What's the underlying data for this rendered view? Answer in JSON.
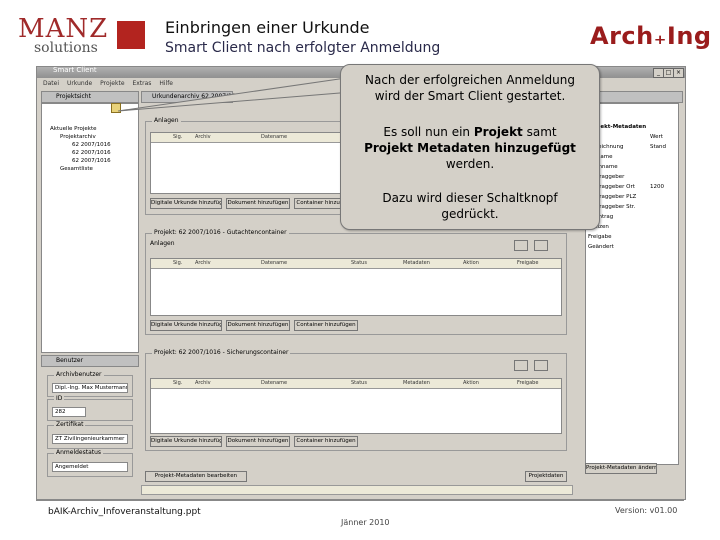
{
  "header": {
    "manz_logo": {
      "main": "MANZ",
      "sub": "solutions"
    },
    "title": "Einbringen einer Urkunde",
    "subtitle": "Smart Client nach erfolgter Anmeldung",
    "arch_logo": "Arch₊Ing"
  },
  "app": {
    "window_title": "Smart Client",
    "menu": [
      "Datei",
      "Urkunde",
      "Projekte",
      "Extras",
      "Hilfe"
    ],
    "tree_panel_tab": "Projektsicht",
    "tree": [
      "Aktuelle Projekte",
      "Projektarchiv",
      "62 2007/1016",
      "62 2007/1016",
      "62 2007/1016",
      "Gesamtliste"
    ],
    "doc_tab": "Urkundenarchiv 62 2007/1016",
    "table_header": [
      "Sig.",
      "Archiv",
      "Datename",
      "Status",
      "Metadaten",
      "Aktion",
      "Freigabe"
    ],
    "group_top_label": "Anlagen",
    "group_top_buttons": [
      "Digitale Urkunde hinzufügen",
      "Dokument hinzufügen",
      "Container hinzufügen"
    ],
    "group_mid_title": "Projekt: 62 2007/1016 - Gutachtencontainer",
    "group_mid_label": "Anlagen",
    "group_mid_buttons": [
      "Digitale Urkunde hinzufügen",
      "Dokument hinzufügen",
      "Container hinzufügen"
    ],
    "group_bot_title": "Projekt: 62 2007/1016 - Sicherungscontainer",
    "group_bot_buttons": [
      "Digitale Urkunde hinzufügen",
      "Dokument hinzufügen",
      "Container hinzufügen"
    ],
    "bottom_button_left": "Projekt-Metadaten bearbeiten",
    "bottom_button_right": "Projektdaten",
    "settings_tab": "Benutzer",
    "settings": [
      {
        "label": "Archivbenutzer",
        "value": "Dipl.-Ing. Max Mustermann"
      },
      {
        "label": "ID",
        "value": "282"
      },
      {
        "label": "Zertifikat",
        "value": "ZT Zivilingenieurkammer"
      },
      {
        "label": "Anmeldestatus",
        "value": "Angemeldet"
      }
    ],
    "right_panel": {
      "header": "Projekt-Metadaten",
      "items": [
        "...",
        "Abzeichnung",
        "Vorname",
        "Nachname",
        "Auftraggeber",
        "Auftraggeber Ort",
        "Auftraggeber PLZ",
        "Auftraggeber Str.",
        "Nachtrag",
        "Notizen",
        "Freigabe",
        "Geändert"
      ],
      "values": [
        "Wert",
        "Stand",
        "",
        "",
        "",
        "1200",
        "",
        ""
      ],
      "button": "Projekt-Metadaten ändern"
    }
  },
  "callout": {
    "line1": "Nach der erfolgreichen Anmeldung",
    "line2": "wird der Smart Client gestartet.",
    "line3_a": "Es soll nun ein ",
    "line3_b": "Projekt",
    "line3_c": " samt",
    "line4": "Projekt Metadaten hinzugefügt",
    "line5": "werden.",
    "line6": "Dazu wird dieser Schaltknopf",
    "line7": "gedrückt."
  },
  "footer": {
    "left": "bAIK-Archiv_Infoveranstaltung.ppt",
    "right": "Version: v01.00",
    "center": "Jänner 2010"
  }
}
